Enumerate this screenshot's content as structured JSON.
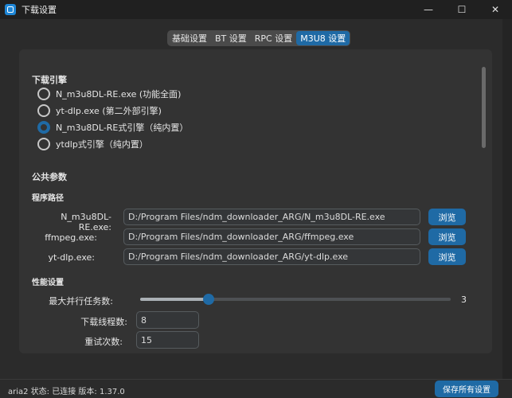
{
  "window": {
    "title": "下载设置",
    "controls": {
      "minimize": "—",
      "maximize": "☐",
      "close": "✕"
    }
  },
  "tabs": [
    {
      "label": "基础设置",
      "active": false
    },
    {
      "label": "BT 设置",
      "active": false
    },
    {
      "label": "RPC 设置",
      "active": false
    },
    {
      "label": "M3U8 设置",
      "active": true
    }
  ],
  "engine": {
    "title": "下载引擎",
    "options": [
      {
        "label": "N_m3u8DL-RE.exe (功能全面)",
        "checked": false
      },
      {
        "label": "yt-dlp.exe (第二外部引擎)",
        "checked": false
      },
      {
        "label": "N_m3u8DL-RE式引擎（纯内置）",
        "checked": true
      },
      {
        "label": "ytdlp式引擎（纯内置）",
        "checked": false
      }
    ]
  },
  "common": {
    "title": "公共参数",
    "paths_title": "程序路径",
    "paths": [
      {
        "label": "N_m3u8DL-RE.exe:",
        "value": "D:/Program Files/ndm_downloader_ARG/N_m3u8DL-RE.exe",
        "button": "浏览"
      },
      {
        "label": "ffmpeg.exe:",
        "value": "D:/Program Files/ndm_downloader_ARG/ffmpeg.exe",
        "button": "浏览"
      },
      {
        "label": "yt-dlp.exe:",
        "value": "D:/Program Files/ndm_downloader_ARG/yt-dlp.exe",
        "button": "浏览"
      }
    ]
  },
  "performance": {
    "title": "性能设置",
    "max_tasks_label": "最大并行任务数:",
    "max_tasks_value": "3",
    "slider_fraction": 0.22,
    "threads_label": "下载线程数:",
    "threads_value": "8",
    "retries_label": "重试次数:",
    "retries_value": "15"
  },
  "status": {
    "text": "aria2 状态: 已连接  版本: 1.37.0",
    "save_button": "保存所有设置"
  },
  "colors": {
    "accent": "#1f6aa5",
    "background": "#2b2b2b",
    "panel": "#333333"
  },
  "icons": {
    "app": "app-window-icon"
  }
}
